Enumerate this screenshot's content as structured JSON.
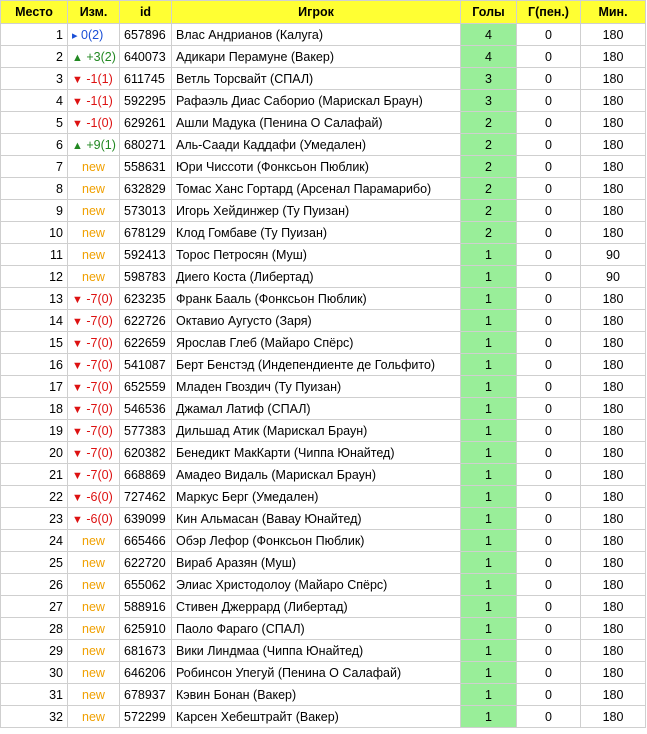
{
  "headers": {
    "place": "Место",
    "change": "Изм.",
    "id": "id",
    "player": "Игрок",
    "goals": "Голы",
    "pen": "Г(пен.)",
    "mins": "Мин."
  },
  "colors": {
    "header_bg": "#ffff33",
    "goals_bg": "#99ee99",
    "up": "#228822",
    "down": "#dd1111",
    "same": "#1a4fd6",
    "new": "#f0a000"
  },
  "rows": [
    {
      "place": "1",
      "change": {
        "type": "same",
        "arrow": "▸",
        "text": "0(2)"
      },
      "id": "657896",
      "player": "Влас Андрианов (Калуга)",
      "goals": "4",
      "pen": "0",
      "mins": "180"
    },
    {
      "place": "2",
      "change": {
        "type": "up",
        "arrow": "▲",
        "text": "+3(2)"
      },
      "id": "640073",
      "player": "Адикари Перамуне (Вакер)",
      "goals": "4",
      "pen": "0",
      "mins": "180"
    },
    {
      "place": "3",
      "change": {
        "type": "down",
        "arrow": "▼",
        "text": "-1(1)"
      },
      "id": "611745",
      "player": "Ветль Торсвайт (СПАЛ)",
      "goals": "3",
      "pen": "0",
      "mins": "180"
    },
    {
      "place": "4",
      "change": {
        "type": "down",
        "arrow": "▼",
        "text": "-1(1)"
      },
      "id": "592295",
      "player": "Рафаэль Диас Саборио (Марискал Браун)",
      "goals": "3",
      "pen": "0",
      "mins": "180"
    },
    {
      "place": "5",
      "change": {
        "type": "down",
        "arrow": "▼",
        "text": "-1(0)"
      },
      "id": "629261",
      "player": "Ашли Мадука (Пенина О Салафай)",
      "goals": "2",
      "pen": "0",
      "mins": "180"
    },
    {
      "place": "6",
      "change": {
        "type": "up",
        "arrow": "▲",
        "text": "+9(1)"
      },
      "id": "680271",
      "player": "Аль-Саади Каддафи (Умедален)",
      "goals": "2",
      "pen": "0",
      "mins": "180"
    },
    {
      "place": "7",
      "change": {
        "type": "new",
        "arrow": "",
        "text": "new"
      },
      "id": "558631",
      "player": "Юри Чиссоти (Фонксьон Пюблик)",
      "goals": "2",
      "pen": "0",
      "mins": "180"
    },
    {
      "place": "8",
      "change": {
        "type": "new",
        "arrow": "",
        "text": "new"
      },
      "id": "632829",
      "player": "Томас Ханс Гортард (Арсенал Парамарибо)",
      "goals": "2",
      "pen": "0",
      "mins": "180"
    },
    {
      "place": "9",
      "change": {
        "type": "new",
        "arrow": "",
        "text": "new"
      },
      "id": "573013",
      "player": "Игорь Хейдинжер (Ту Пуизан)",
      "goals": "2",
      "pen": "0",
      "mins": "180"
    },
    {
      "place": "10",
      "change": {
        "type": "new",
        "arrow": "",
        "text": "new"
      },
      "id": "678129",
      "player": "Клод Гомбаве (Ту Пуизан)",
      "goals": "2",
      "pen": "0",
      "mins": "180"
    },
    {
      "place": "11",
      "change": {
        "type": "new",
        "arrow": "",
        "text": "new"
      },
      "id": "592413",
      "player": "Торос Петросян (Муш)",
      "goals": "1",
      "pen": "0",
      "mins": "90"
    },
    {
      "place": "12",
      "change": {
        "type": "new",
        "arrow": "",
        "text": "new"
      },
      "id": "598783",
      "player": "Диего Коста (Либертад)",
      "goals": "1",
      "pen": "0",
      "mins": "90"
    },
    {
      "place": "13",
      "change": {
        "type": "down",
        "arrow": "▼",
        "text": "-7(0)"
      },
      "id": "623235",
      "player": "Франк Бааль (Фонксьон Пюблик)",
      "goals": "1",
      "pen": "0",
      "mins": "180"
    },
    {
      "place": "14",
      "change": {
        "type": "down",
        "arrow": "▼",
        "text": "-7(0)"
      },
      "id": "622726",
      "player": "Октавио Аугусто (Заря)",
      "goals": "1",
      "pen": "0",
      "mins": "180"
    },
    {
      "place": "15",
      "change": {
        "type": "down",
        "arrow": "▼",
        "text": "-7(0)"
      },
      "id": "622659",
      "player": "Ярослав Глеб (Майаро Спёрс)",
      "goals": "1",
      "pen": "0",
      "mins": "180"
    },
    {
      "place": "16",
      "change": {
        "type": "down",
        "arrow": "▼",
        "text": "-7(0)"
      },
      "id": "541087",
      "player": "Берт Бенстэд (Индепендиенте де Гольфито)",
      "goals": "1",
      "pen": "0",
      "mins": "180"
    },
    {
      "place": "17",
      "change": {
        "type": "down",
        "arrow": "▼",
        "text": "-7(0)"
      },
      "id": "652559",
      "player": "Младен Гвоздич (Ту Пуизан)",
      "goals": "1",
      "pen": "0",
      "mins": "180"
    },
    {
      "place": "18",
      "change": {
        "type": "down",
        "arrow": "▼",
        "text": "-7(0)"
      },
      "id": "546536",
      "player": "Джамал Латиф (СПАЛ)",
      "goals": "1",
      "pen": "0",
      "mins": "180"
    },
    {
      "place": "19",
      "change": {
        "type": "down",
        "arrow": "▼",
        "text": "-7(0)"
      },
      "id": "577383",
      "player": "Дильшад Атик (Марискал Браун)",
      "goals": "1",
      "pen": "0",
      "mins": "180"
    },
    {
      "place": "20",
      "change": {
        "type": "down",
        "arrow": "▼",
        "text": "-7(0)"
      },
      "id": "620382",
      "player": "Бенедикт МакКарти (Чиппа Юнайтед)",
      "goals": "1",
      "pen": "0",
      "mins": "180"
    },
    {
      "place": "21",
      "change": {
        "type": "down",
        "arrow": "▼",
        "text": "-7(0)"
      },
      "id": "668869",
      "player": "Амадео Видаль (Марискал Браун)",
      "goals": "1",
      "pen": "0",
      "mins": "180"
    },
    {
      "place": "22",
      "change": {
        "type": "down",
        "arrow": "▼",
        "text": "-6(0)"
      },
      "id": "727462",
      "player": "Маркус Берг (Умедален)",
      "goals": "1",
      "pen": "0",
      "mins": "180"
    },
    {
      "place": "23",
      "change": {
        "type": "down",
        "arrow": "▼",
        "text": "-6(0)"
      },
      "id": "639099",
      "player": "Кин Альмасан (Вавау Юнайтед)",
      "goals": "1",
      "pen": "0",
      "mins": "180"
    },
    {
      "place": "24",
      "change": {
        "type": "new",
        "arrow": "",
        "text": "new"
      },
      "id": "665466",
      "player": "Обэр Лефор (Фонксьон Пюблик)",
      "goals": "1",
      "pen": "0",
      "mins": "180"
    },
    {
      "place": "25",
      "change": {
        "type": "new",
        "arrow": "",
        "text": "new"
      },
      "id": "622720",
      "player": "Вираб Аразян (Муш)",
      "goals": "1",
      "pen": "0",
      "mins": "180"
    },
    {
      "place": "26",
      "change": {
        "type": "new",
        "arrow": "",
        "text": "new"
      },
      "id": "655062",
      "player": "Элиас Христодолоу (Майаро Спёрс)",
      "goals": "1",
      "pen": "0",
      "mins": "180"
    },
    {
      "place": "27",
      "change": {
        "type": "new",
        "arrow": "",
        "text": "new"
      },
      "id": "588916",
      "player": "Стивен Джеррард (Либертад)",
      "goals": "1",
      "pen": "0",
      "mins": "180"
    },
    {
      "place": "28",
      "change": {
        "type": "new",
        "arrow": "",
        "text": "new"
      },
      "id": "625910",
      "player": "Паоло Фараго (СПАЛ)",
      "goals": "1",
      "pen": "0",
      "mins": "180"
    },
    {
      "place": "29",
      "change": {
        "type": "new",
        "arrow": "",
        "text": "new"
      },
      "id": "681673",
      "player": "Вики Линдмаа (Чиппа Юнайтед)",
      "goals": "1",
      "pen": "0",
      "mins": "180"
    },
    {
      "place": "30",
      "change": {
        "type": "new",
        "arrow": "",
        "text": "new"
      },
      "id": "646206",
      "player": "Робинсон Упегуй (Пенина О Салафай)",
      "goals": "1",
      "pen": "0",
      "mins": "180"
    },
    {
      "place": "31",
      "change": {
        "type": "new",
        "arrow": "",
        "text": "new"
      },
      "id": "678937",
      "player": "Кэвин Бонан (Вакер)",
      "goals": "1",
      "pen": "0",
      "mins": "180"
    },
    {
      "place": "32",
      "change": {
        "type": "new",
        "arrow": "",
        "text": "new"
      },
      "id": "572299",
      "player": "Карсен Хебештрайт (Вакер)",
      "goals": "1",
      "pen": "0",
      "mins": "180"
    }
  ]
}
